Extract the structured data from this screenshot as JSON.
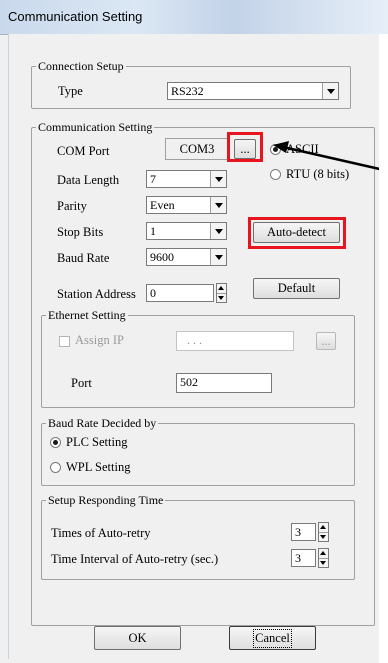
{
  "window": {
    "title": "Communication Setting"
  },
  "connection_setup": {
    "legend": "Connection Setup",
    "type_label": "Type",
    "type_value": "RS232"
  },
  "communication_setting": {
    "legend": "Communication Setting",
    "com_port_label": "COM Port",
    "com_port_value": "COM3",
    "browse_label": "...",
    "protocol_options": [
      "ASCII",
      "RTU (8 bits)"
    ],
    "protocol_selected": "ASCII",
    "data_length_label": "Data Length",
    "data_length_value": "7",
    "parity_label": "Parity",
    "parity_value": "Even",
    "stop_bits_label": "Stop Bits",
    "stop_bits_value": "1",
    "auto_detect_label": "Auto-detect",
    "baud_rate_label": "Baud Rate",
    "baud_rate_value": "9600",
    "station_address_label": "Station Address",
    "station_address_value": "0",
    "default_label": "Default"
  },
  "ethernet_setting": {
    "legend": "Ethernet Setting",
    "assign_ip_label": "Assign IP",
    "ip_value": ". . .",
    "ip_browse_label": "...",
    "port_label": "Port",
    "port_value": "502"
  },
  "baud_rate_decided": {
    "legend": "Baud Rate Decided by",
    "options": [
      "PLC Setting",
      "WPL Setting"
    ],
    "selected": "PLC Setting"
  },
  "responding_time": {
    "legend": "Setup Responding Time",
    "retry_label": "Times of Auto-retry",
    "retry_value": "3",
    "interval_label": "Time Interval of Auto-retry (sec.)",
    "interval_value": "3"
  },
  "footer": {
    "ok_label": "OK",
    "cancel_label": "Cancel"
  },
  "annotations": {
    "highlight_color": "#e8141e",
    "arrow_color": "#000000"
  }
}
